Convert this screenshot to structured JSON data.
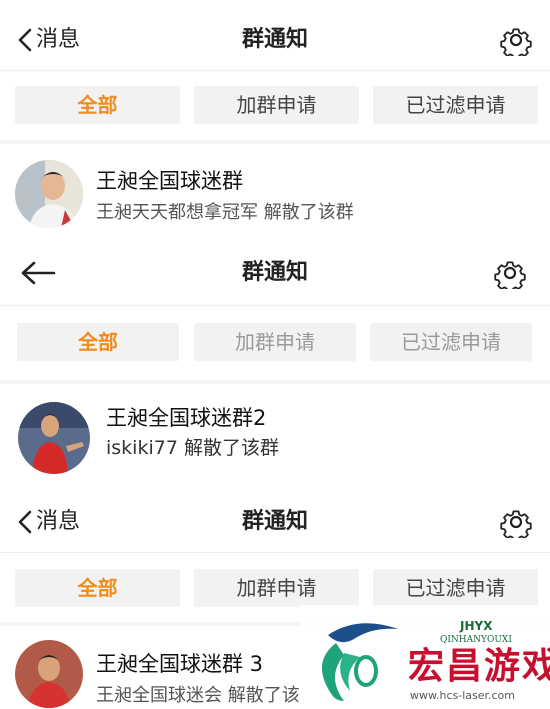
{
  "panels": [
    {
      "back_label": "消息",
      "title": "群通知",
      "tabs": [
        "全部",
        "加群申请",
        "已过滤申请"
      ],
      "item": {
        "title": "王昶全国球迷群",
        "subtitle": "王昶天天都想拿冠军 解散了该群"
      }
    },
    {
      "back_label": "",
      "title": "群通知",
      "tabs": [
        "全部",
        "加群申请",
        "已过滤申请"
      ],
      "item": {
        "title": "王昶全国球迷群2",
        "subtitle": "iskiki77 解散了该群"
      }
    },
    {
      "back_label": "消息",
      "title": "群通知",
      "tabs": [
        "全部",
        "加群申请",
        "已过滤申请"
      ],
      "item": {
        "title": "王昶全国球迷群 3",
        "subtitle": "王昶全国球迷会 解散了该"
      }
    }
  ],
  "watermark": {
    "brand_top": "JHYX",
    "brand": "QINHANYOUXI",
    "name": "宏昌游戏网",
    "url": "www.hcs-laser.com"
  },
  "colors": {
    "active_tab": "#f08c1e",
    "tab_bg": "#f2f2f2",
    "watermark_red": "#c8102e"
  }
}
